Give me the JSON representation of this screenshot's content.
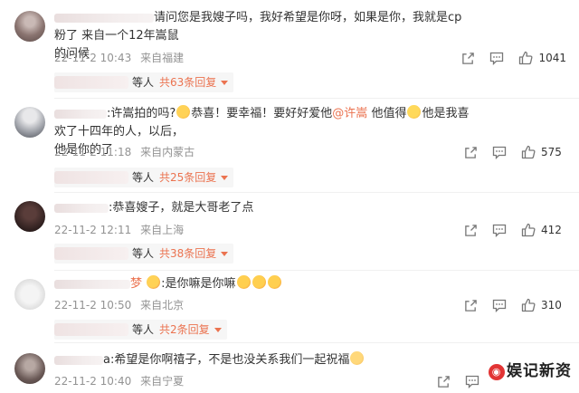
{
  "comments": [
    {
      "text_line1": "请问您是我嫂子吗，我好希望是你呀，如果是你，我就是cp粉了   来自一个12年嵩鼠",
      "text_line2": "的问候",
      "time": "22-11-2 10:43",
      "location": "来自福建",
      "likes": "1041",
      "replies_label": "等人",
      "replies_count": "共63条回复"
    },
    {
      "text_prefix": ":许嵩拍的吗?",
      "text_mid": "恭喜！要幸福！要好好爱他",
      "mention": "@许嵩",
      "text_after_mention": " 他值得",
      "text_end": "他是我喜欢了十四年的人，以后，",
      "text_line2": "他是你的了",
      "time": "22-11-2 11:18",
      "location": "来自内蒙古",
      "likes": "575",
      "replies_label": "等人",
      "replies_count": "共25条回复"
    },
    {
      "text_line1": ":恭喜嫂子，就是大哥老了点",
      "time": "22-11-2 12:11",
      "location": "来自上海",
      "likes": "412",
      "replies_label": "等人",
      "replies_count": "共38条回复"
    },
    {
      "name_suffix": "梦",
      "text_line1": ":是你嘛是你嘛",
      "time": "22-11-2 10:50",
      "location": "来自北京",
      "likes": "310",
      "replies_label": "等人",
      "replies_count": "共2条回复"
    },
    {
      "text_line1": "a:希望是你啊禧子，不是也没关系我们一起祝福",
      "time": "22-11-2 10:40",
      "location": "来自宁夏"
    }
  ],
  "icons": {
    "share": "share-icon",
    "comment": "comment-icon",
    "like": "thumbs-up-icon"
  },
  "colors": {
    "accent": "#eb7350",
    "meta": "#939393"
  },
  "watermark": "娱记新资"
}
